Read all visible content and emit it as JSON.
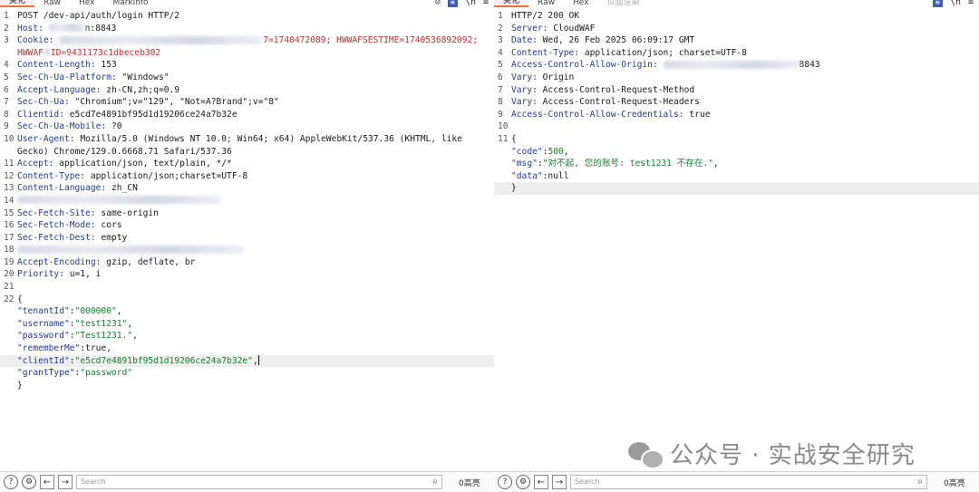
{
  "left": {
    "tabs": [
      "美化",
      "Raw",
      "Hex",
      "Markinfo"
    ],
    "lines": [
      {
        "n": "1",
        "parts": [
          {
            "t": "POST /dev-api/auth/login HTTP/2",
            "c": "val"
          }
        ]
      },
      {
        "n": "2",
        "parts": [
          {
            "t": "Host: ",
            "c": "hk"
          },
          {
            "t": "",
            "c": "blur",
            "w": 40
          },
          {
            "t": "n:8843",
            "c": "val"
          }
        ]
      },
      {
        "n": "3",
        "parts": [
          {
            "t": "Cookie: ",
            "c": "hk"
          },
          {
            "t": "",
            "c": "blur",
            "w": 225
          },
          {
            "t": "7=1740472089; HWWAFSESTIME=1740536892092;",
            "c": "red"
          }
        ]
      },
      {
        "n": "",
        "parts": [
          {
            "t": "HWWAF",
            "c": "red"
          },
          {
            "t": "",
            "c": "blur",
            "w": 8
          },
          {
            "t": "ID=9431173c1dbeceb302",
            "c": "red"
          }
        ]
      },
      {
        "n": "4",
        "parts": [
          {
            "t": "Content-Length: ",
            "c": "hk"
          },
          {
            "t": "153",
            "c": "val"
          }
        ]
      },
      {
        "n": "5",
        "parts": [
          {
            "t": "Sec-Ch-Ua-Platform: ",
            "c": "hk"
          },
          {
            "t": "\"Windows\"",
            "c": "val"
          }
        ]
      },
      {
        "n": "6",
        "parts": [
          {
            "t": "Accept-Language: ",
            "c": "hk"
          },
          {
            "t": "zh-CN,zh;q=0.9",
            "c": "val"
          }
        ]
      },
      {
        "n": "7",
        "parts": [
          {
            "t": "Sec-Ch-Ua: ",
            "c": "hk"
          },
          {
            "t": "\"Chromium\";v=\"129\", \"Not=A?Brand\";v=\"8\"",
            "c": "val"
          }
        ]
      },
      {
        "n": "8",
        "parts": [
          {
            "t": "Clientid: ",
            "c": "hk"
          },
          {
            "t": "e5cd7e4891bf95d1d19206ce24a7b32e",
            "c": "val"
          }
        ]
      },
      {
        "n": "9",
        "parts": [
          {
            "t": "Sec-Ch-Ua-Mobile: ",
            "c": "hk"
          },
          {
            "t": "?0",
            "c": "val"
          }
        ]
      },
      {
        "n": "10",
        "parts": [
          {
            "t": "User-Agent: ",
            "c": "hk"
          },
          {
            "t": "Mozilla/5.0 (Windows NT 10.0; Win64; x64) AppleWebKit/537.36 (KHTML, like",
            "c": "val"
          }
        ]
      },
      {
        "n": "",
        "parts": [
          {
            "t": "Gecko) Chrome/129.0.6668.71 Safari/537.36",
            "c": "val"
          }
        ]
      },
      {
        "n": "11",
        "parts": [
          {
            "t": "Accept: ",
            "c": "hk"
          },
          {
            "t": "application/json, text/plain, */*",
            "c": "val"
          }
        ]
      },
      {
        "n": "12",
        "parts": [
          {
            "t": "Content-Type: ",
            "c": "hk"
          },
          {
            "t": "application/json;charset=UTF-8",
            "c": "val"
          }
        ]
      },
      {
        "n": "13",
        "parts": [
          {
            "t": "Content-Language: ",
            "c": "hk"
          },
          {
            "t": "zh_CN",
            "c": "val"
          }
        ]
      },
      {
        "n": "14",
        "parts": [
          {
            "t": "",
            "c": "blur",
            "w": 225
          }
        ]
      },
      {
        "n": "15",
        "parts": [
          {
            "t": "Sec-Fetch-Site: ",
            "c": "hk"
          },
          {
            "t": "same-origin",
            "c": "val"
          }
        ]
      },
      {
        "n": "16",
        "parts": [
          {
            "t": "Sec-Fetch-Mode: ",
            "c": "hk"
          },
          {
            "t": "cors",
            "c": "val"
          }
        ]
      },
      {
        "n": "17",
        "parts": [
          {
            "t": "Sec-Fetch-Dest: ",
            "c": "hk"
          },
          {
            "t": "empty",
            "c": "val"
          }
        ]
      },
      {
        "n": "18",
        "parts": [
          {
            "t": "",
            "c": "blur",
            "w": 250
          }
        ]
      },
      {
        "n": "19",
        "parts": [
          {
            "t": "Accept-Encoding: ",
            "c": "hk"
          },
          {
            "t": "gzip, deflate, br",
            "c": "val"
          }
        ]
      },
      {
        "n": "20",
        "parts": [
          {
            "t": "Priority: ",
            "c": "hk"
          },
          {
            "t": "u=1, i",
            "c": "val"
          }
        ]
      },
      {
        "n": "21",
        "parts": []
      },
      {
        "n": "22",
        "parts": [
          {
            "t": "{",
            "c": "val"
          }
        ]
      },
      {
        "n": "",
        "parts": [
          {
            "t": "    \"tenantId\"",
            "c": "jk"
          },
          {
            "t": ":",
            "c": "val"
          },
          {
            "t": "\"000000\"",
            "c": "js"
          },
          {
            "t": ",",
            "c": "val"
          }
        ]
      },
      {
        "n": "",
        "parts": [
          {
            "t": "    \"username\"",
            "c": "jk"
          },
          {
            "t": ":",
            "c": "val"
          },
          {
            "t": "\"test1231\"",
            "c": "js"
          },
          {
            "t": ",",
            "c": "val"
          }
        ]
      },
      {
        "n": "",
        "parts": [
          {
            "t": "    \"password\"",
            "c": "jk"
          },
          {
            "t": ":",
            "c": "val"
          },
          {
            "t": "\"Test1231.\"",
            "c": "js"
          },
          {
            "t": ",",
            "c": "val"
          }
        ]
      },
      {
        "n": "",
        "parts": [
          {
            "t": "    \"rememberMe\"",
            "c": "jk"
          },
          {
            "t": ":true,",
            "c": "val"
          }
        ]
      },
      {
        "n": "",
        "hl": true,
        "cursor": true,
        "parts": [
          {
            "t": "    \"clientId\"",
            "c": "jk"
          },
          {
            "t": ":",
            "c": "val"
          },
          {
            "t": "\"e5cd7e4891bf95d1d19206ce24a7b32e\"",
            "c": "js"
          },
          {
            "t": ",",
            "c": "val"
          }
        ]
      },
      {
        "n": "",
        "parts": [
          {
            "t": "    \"grantType\"",
            "c": "jk"
          },
          {
            "t": ":",
            "c": "val"
          },
          {
            "t": "\"password\"",
            "c": "js"
          }
        ]
      },
      {
        "n": "",
        "parts": [
          {
            "t": "}",
            "c": "val"
          }
        ]
      }
    ],
    "search_placeholder": "Search",
    "matches": "0高亮"
  },
  "right": {
    "tabs": [
      "美化",
      "Raw",
      "Hex",
      "页面渲染"
    ],
    "lines": [
      {
        "n": "1",
        "parts": [
          {
            "t": "HTTP/2 200 OK",
            "c": "val"
          }
        ]
      },
      {
        "n": "2",
        "parts": [
          {
            "t": "Server: ",
            "c": "hk"
          },
          {
            "t": "CloudWAF",
            "c": "val"
          }
        ]
      },
      {
        "n": "3",
        "parts": [
          {
            "t": "Date: ",
            "c": "hk"
          },
          {
            "t": "Wed, 26 Feb 2025 06:09:17 GMT",
            "c": "val"
          }
        ]
      },
      {
        "n": "4",
        "parts": [
          {
            "t": "Content-Type: ",
            "c": "hk"
          },
          {
            "t": "application/json; charset=UTF-8",
            "c": "val"
          }
        ]
      },
      {
        "n": "5",
        "parts": [
          {
            "t": "Access-Control-Allow-Origin: ",
            "c": "hk"
          },
          {
            "t": "",
            "c": "blur",
            "w": 150
          },
          {
            "t": "8843",
            "c": "val"
          }
        ]
      },
      {
        "n": "6",
        "parts": [
          {
            "t": "Vary: ",
            "c": "hk"
          },
          {
            "t": "Origin",
            "c": "val"
          }
        ]
      },
      {
        "n": "7",
        "parts": [
          {
            "t": "Vary: ",
            "c": "hk"
          },
          {
            "t": "Access-Control-Request-Method",
            "c": "val"
          }
        ]
      },
      {
        "n": "8",
        "parts": [
          {
            "t": "Vary: ",
            "c": "hk"
          },
          {
            "t": "Access-Control-Request-Headers",
            "c": "val"
          }
        ]
      },
      {
        "n": "9",
        "parts": [
          {
            "t": "Access-Control-Allow-Credentials: ",
            "c": "hk"
          },
          {
            "t": "true",
            "c": "val"
          }
        ]
      },
      {
        "n": "10",
        "parts": []
      },
      {
        "n": "11",
        "parts": [
          {
            "t": "{",
            "c": "val"
          }
        ]
      },
      {
        "n": "",
        "parts": [
          {
            "t": "    \"code\"",
            "c": "jk"
          },
          {
            "t": ":",
            "c": "val"
          },
          {
            "t": "500",
            "c": "jn"
          },
          {
            "t": ",",
            "c": "val"
          }
        ]
      },
      {
        "n": "",
        "parts": [
          {
            "t": "    \"msg\"",
            "c": "jk"
          },
          {
            "t": ":",
            "c": "val"
          },
          {
            "t": "\"对不起, 您的账号: test1231 不存在.\"",
            "c": "js"
          },
          {
            "t": ",",
            "c": "val"
          }
        ]
      },
      {
        "n": "",
        "parts": [
          {
            "t": "    \"data\"",
            "c": "jk"
          },
          {
            "t": ":null",
            "c": "val"
          }
        ]
      },
      {
        "n": "",
        "hl": true,
        "parts": [
          {
            "t": "}",
            "c": "val"
          }
        ]
      }
    ],
    "search_placeholder": "Search",
    "matches": "0高亮"
  },
  "watermark": "公众号 · 实战安全研究",
  "icons": [
    "help-icon",
    "gear-icon",
    "arrow-left-icon",
    "arrow-right-icon",
    "search-icon"
  ]
}
